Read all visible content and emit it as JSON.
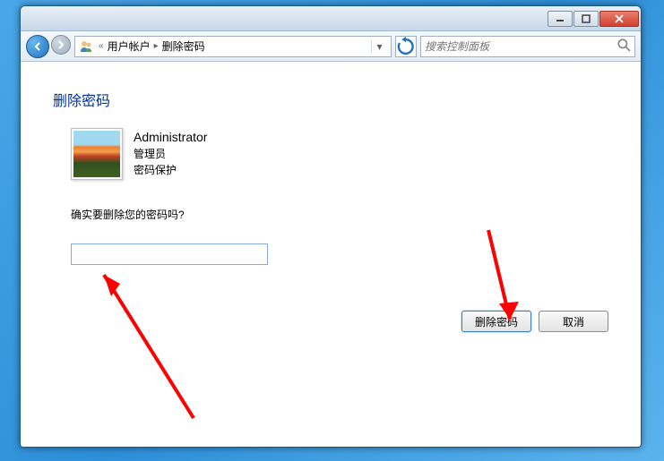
{
  "breadcrumb": {
    "item1": "用户帐户",
    "item2": "删除密码"
  },
  "search": {
    "placeholder": "搜索控制面板"
  },
  "page": {
    "title": "删除密码"
  },
  "user": {
    "name": "Administrator",
    "role": "管理员",
    "pwd_status": "密码保护"
  },
  "prompt": "确实要删除您的密码吗?",
  "password_value": "",
  "buttons": {
    "confirm": "删除密码",
    "cancel": "取消"
  }
}
